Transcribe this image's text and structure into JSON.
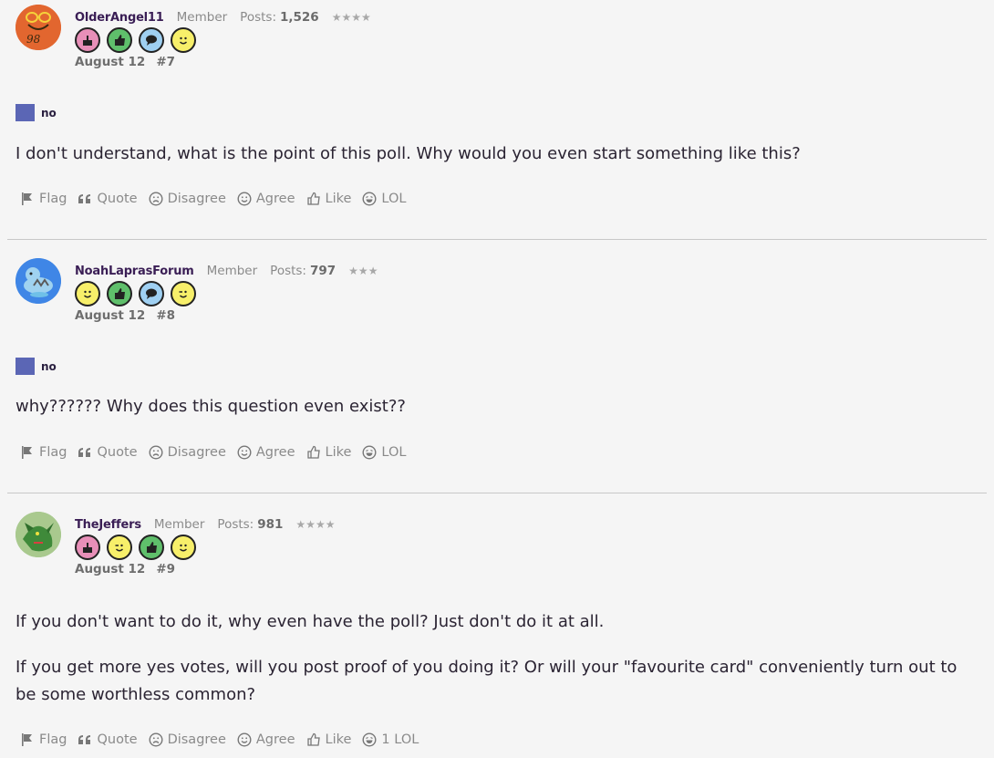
{
  "posts": [
    {
      "username": "OlderAngel11",
      "rank": "Member",
      "posts_label": "Posts:",
      "posts_count": "1,526",
      "stars": "★★★★",
      "date": "August 12",
      "post_number": "#7",
      "vote": "no",
      "body": [
        "I don't understand, what is the point of this poll. Why would you even start something like this?"
      ],
      "badges": [
        "cake-badge-icon",
        "thumbs-up-badge-icon",
        "speech-bubble-badge-icon",
        "smile-badge-icon"
      ]
    },
    {
      "username": "NoahLaprasForum",
      "rank": "Member",
      "posts_label": "Posts:",
      "posts_count": "797",
      "stars": "★★★",
      "date": "August 12",
      "post_number": "#8",
      "vote": "no",
      "body": [
        "why?????? Why does this question even exist??"
      ],
      "badges": [
        "smile-badge-icon",
        "thumbs-up-badge-icon",
        "speech-bubble-badge-icon",
        "wink-badge-icon"
      ]
    },
    {
      "username": "TheJeffers",
      "rank": "Member",
      "posts_label": "Posts:",
      "posts_count": "981",
      "stars": "★★★★",
      "date": "August 12",
      "post_number": "#9",
      "vote": "",
      "body": [
        "If you don't want to do it, why even have the poll? Just don't do it at all.",
        "If you get more yes votes, will you post proof of you doing it? Or will your \"favourite card\" conveniently turn out to be some worthless common?"
      ],
      "badges": [
        "cake-badge-icon",
        "wink-badge-icon",
        "thumbs-up-badge-icon",
        "smile-badge-icon"
      ]
    }
  ],
  "actions": {
    "flag": "Flag",
    "quote": "Quote",
    "disagree": "Disagree",
    "agree": "Agree",
    "like": "Like",
    "lol": "LOL",
    "lol_with_count": "1 LOL"
  },
  "colors": {
    "background": "#f5f5f5",
    "username": "#3a1e55",
    "vote_square": "#5b66b5",
    "muted": "#8a8a8a",
    "badge_cake": "#e88fb8",
    "badge_thumb": "#5fbf6b",
    "badge_speech": "#9fd0f2",
    "badge_smile": "#f7ef6a"
  }
}
